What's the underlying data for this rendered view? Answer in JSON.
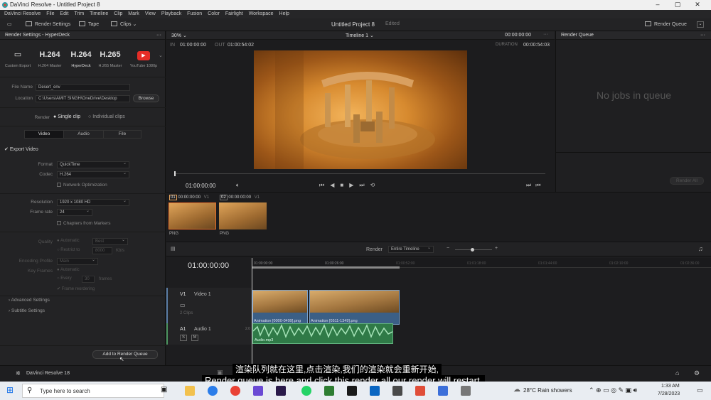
{
  "window": {
    "title": "DaVinci Resolve - Untitled Project 8"
  },
  "menu": [
    "DaVinci Resolve",
    "File",
    "Edit",
    "Trim",
    "Timeline",
    "Clip",
    "Mark",
    "View",
    "Playback",
    "Fusion",
    "Color",
    "Fairlight",
    "Workspace",
    "Help"
  ],
  "toolbar": {
    "render_settings": "Render Settings",
    "tape": "Tape",
    "clips": "Clips",
    "project_title": "Untitled Project 8",
    "status": "Edited",
    "render_queue": "Render Queue"
  },
  "render_settings": {
    "header": "Render Settings - HyperDeck",
    "presets": [
      {
        "icon": "▭",
        "label": "Custom Export"
      },
      {
        "icon": "H.264",
        "label": "H.264 Master"
      },
      {
        "icon": "H.264",
        "label": "HyperDeck"
      },
      {
        "icon": "H.265",
        "label": "H.265 Master"
      },
      {
        "icon": "▶",
        "label": "YouTube 1080p"
      }
    ],
    "file_name_label": "File Name",
    "file_name": "Desert_env",
    "location_label": "Location",
    "location": "C:\\Users\\AMIT SINGH\\OneDrive\\Desktop",
    "browse": "Browse",
    "render_label": "Render",
    "single_clip": "Single clip",
    "individual_clips": "Individual clips",
    "tabs": [
      "Video",
      "Audio",
      "File"
    ],
    "export_video": "Export Video",
    "format_label": "Format",
    "format": "QuickTime",
    "codec_label": "Codec",
    "codec": "H.264",
    "network_opt": "Network Optimization",
    "resolution_label": "Resolution",
    "resolution": "1920 x 1080 HD",
    "framerate_label": "Frame rate",
    "framerate": "24",
    "chapters": "Chapters from Markers",
    "quality_label": "Quality",
    "quality_auto": "Automatic",
    "quality_val": "Best",
    "restrict_to": "Restrict to",
    "restrict_val": "8000",
    "kbs": "Kb/s",
    "encoding_label": "Encoding Profile",
    "encoding": "Main",
    "keyframes_label": "Key Frames",
    "keyframes_auto": "Automatic",
    "every": "Every",
    "every_val": "30",
    "frames": "frames",
    "frame_reorder": "Frame reordering",
    "advanced": "Advanced Settings",
    "subtitle": "Subtitle Settings",
    "add_to_queue": "Add to Render Queue"
  },
  "viewer": {
    "zoom": "30%",
    "timeline_name": "Timeline 1",
    "top_tc": "00:00:00:00",
    "in_label": "IN",
    "in_tc": "01:00:00:00",
    "out_label": "OUT",
    "out_tc": "01:00:54:02",
    "duration_label": "DURATION",
    "duration_tc": "00:00:54:03",
    "current_tc": "01:00:00:00"
  },
  "render_queue": {
    "header": "Render Queue",
    "empty": "No jobs in queue",
    "render_all": "Render All"
  },
  "clips": [
    {
      "index": "01",
      "tc": "00:00:00:00",
      "track": "V1",
      "type": "PNG"
    },
    {
      "index": "02",
      "tc": "00:00:00:00",
      "track": "V1",
      "type": "PNG"
    }
  ],
  "timeline": {
    "render_label": "Render",
    "render_mode": "Entire Timeline",
    "tc": "01:00:00:00",
    "ruler": [
      "01:00:00:00",
      "01:00:26:00",
      "01:00:52:00",
      "01:01:18:00",
      "01:01:44:00",
      "01:02:10:00",
      "01:02:36:00"
    ],
    "v1": {
      "id": "V1",
      "name": "Video 1",
      "clips_count": "2 Clips"
    },
    "a1": {
      "id": "A1",
      "name": "Audio 1",
      "level": "2.0"
    },
    "video_clips": [
      "Animation [0000-0499].png",
      "Animation [0511-1349].png"
    ],
    "audio_clip": "Audio.mp3"
  },
  "bottom": {
    "app": "DaVinci Resolve 18"
  },
  "subtitles": {
    "zh": "渲染队列就在这里,点击渲染,我们的渲染就会重新开始,",
    "en": "Render queue is here and click this render all our render will restart."
  },
  "taskbar": {
    "search": "Type here to search",
    "weather": "28°C  Rain showers",
    "time": "1:33 AM",
    "date": "7/28/2023"
  }
}
